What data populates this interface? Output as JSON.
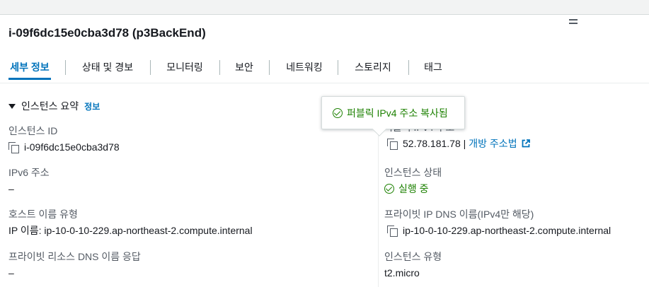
{
  "instance": {
    "title": "i-09f6dc15e0cba3d78 (p3BackEnd)"
  },
  "tabs": [
    {
      "label": "세부 정보",
      "active": true
    },
    {
      "label": "상태 및 경보"
    },
    {
      "label": "모니터링"
    },
    {
      "label": "보안"
    },
    {
      "label": "네트워킹"
    },
    {
      "label": "스토리지"
    },
    {
      "label": "태그"
    }
  ],
  "summary": {
    "title": "인스턴스 요약",
    "info_link": "정보"
  },
  "left": {
    "instance_id_label": "인스턴스 ID",
    "instance_id_value": "i-09f6dc15e0cba3d78",
    "ipv6_label": "IPv6 주소",
    "ipv6_value": "–",
    "hostname_type_label": "호스트 이름 유형",
    "hostname_type_value": "IP 이름: ip-10-0-10-229.ap-northeast-2.compute.internal",
    "private_dns_label": "프라이빗 리소스 DNS 이름 응답",
    "private_dns_value": "–"
  },
  "right": {
    "public_ip_label": "퍼블릭 IPv4 주소",
    "public_ip_value": "52.78.181.78 |",
    "open_address_link": "개방 주소법",
    "state_label": "인스턴스 상태",
    "state_value": "실행 중",
    "private_dns_name_label": "프라이빗 IP DNS 이름(IPv4만 해당)",
    "private_dns_name_value": "ip-10-0-10-229.ap-northeast-2.compute.internal",
    "instance_type_label": "인스턴스 유형",
    "instance_type_value": "t2.micro"
  },
  "popover": {
    "message": "퍼블릭 IPv4 주소 복사됨"
  },
  "icons": {
    "copy": "copy-icon",
    "success": "check-circle-icon",
    "external": "external-link-icon",
    "caret": "caret-down-icon",
    "collapse": "menu-collapse-icon"
  },
  "colors": {
    "accent": "#0073bb",
    "success": "#1d8102",
    "text": "#16191f",
    "label": "#545b64"
  }
}
